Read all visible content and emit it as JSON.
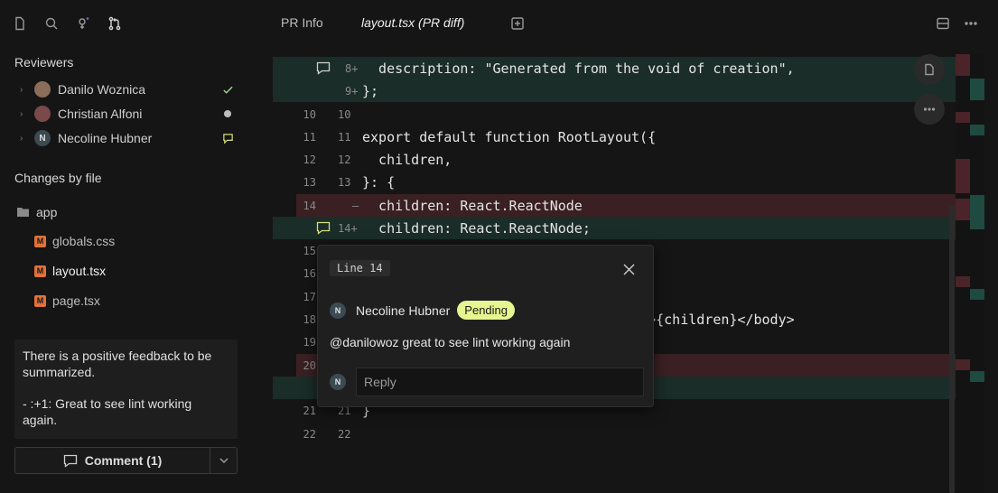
{
  "tabs": {
    "pr_info": "PR Info",
    "layout_diff": "layout.tsx (PR diff)"
  },
  "sidebar": {
    "reviewers_title": "Reviewers",
    "reviewers": [
      {
        "name": "Danilo Woznica",
        "status": "approved"
      },
      {
        "name": "Christian Alfoni",
        "status": "pending-dot"
      },
      {
        "name": "Necoline Hubner",
        "status": "commented",
        "initial": "N"
      }
    ],
    "changes_title": "Changes by file",
    "folder": "app",
    "files": [
      {
        "name": "globals.css",
        "badge": "M"
      },
      {
        "name": "layout.tsx",
        "badge": "M"
      },
      {
        "name": "page.tsx",
        "badge": "M"
      }
    ],
    "summary": {
      "line1": "There is a positive feedback to be summarized.",
      "line2": "- :+1: Great to see lint working again."
    },
    "comment_button": "Comment (1)"
  },
  "diff": {
    "rows": [
      {
        "old": "",
        "new": "8+",
        "code": "  description: \"Generated from the void of creation\",",
        "kind": "add"
      },
      {
        "old": "",
        "new": "9+",
        "code": "};",
        "kind": "add"
      },
      {
        "old": "10",
        "new": "10",
        "code": "",
        "kind": "ctx"
      },
      {
        "old": "11",
        "new": "11",
        "code": "export default function RootLayout({",
        "kind": "ctx"
      },
      {
        "old": "12",
        "new": "12",
        "code": "  children,",
        "kind": "ctx"
      },
      {
        "old": "13",
        "new": "13",
        "code": "}: {",
        "kind": "ctx"
      },
      {
        "old": "14",
        "new": "—",
        "code": "  children: React.ReactNode",
        "kind": "del"
      },
      {
        "old": "",
        "new": "14+",
        "code": "  children: React.ReactNode;",
        "kind": "add"
      },
      {
        "old": "15",
        "new": "",
        "code": "",
        "kind": "ctx"
      },
      {
        "old": "16",
        "new": "",
        "code": "",
        "kind": "ctx"
      },
      {
        "old": "17",
        "new": "",
        "code": "",
        "kind": "ctx"
      },
      {
        "old": "18",
        "new": "",
        "code": "                              Name}>{children}</body>",
        "kind": "ctx"
      },
      {
        "old": "19",
        "new": "",
        "code": "",
        "kind": "ctx"
      },
      {
        "old": "20",
        "new": "",
        "code": "",
        "kind": "del"
      },
      {
        "old": "",
        "new": "",
        "code": "",
        "kind": "add"
      },
      {
        "old": "21",
        "new": "21",
        "code": "}",
        "kind": "ctx"
      },
      {
        "old": "22",
        "new": "22",
        "code": "",
        "kind": "ctx"
      }
    ]
  },
  "popup": {
    "line_label": "Line 14",
    "author": "Necoline Hubner",
    "author_initial": "N",
    "status": "Pending",
    "message": "@danilowoz great to see lint working again",
    "reply_placeholder": "Reply"
  },
  "colors": {
    "added_bg": "#1b2d28",
    "deleted_bg": "#3a2023",
    "pending": "#e6f590",
    "modified_badge": "#e0723a"
  }
}
